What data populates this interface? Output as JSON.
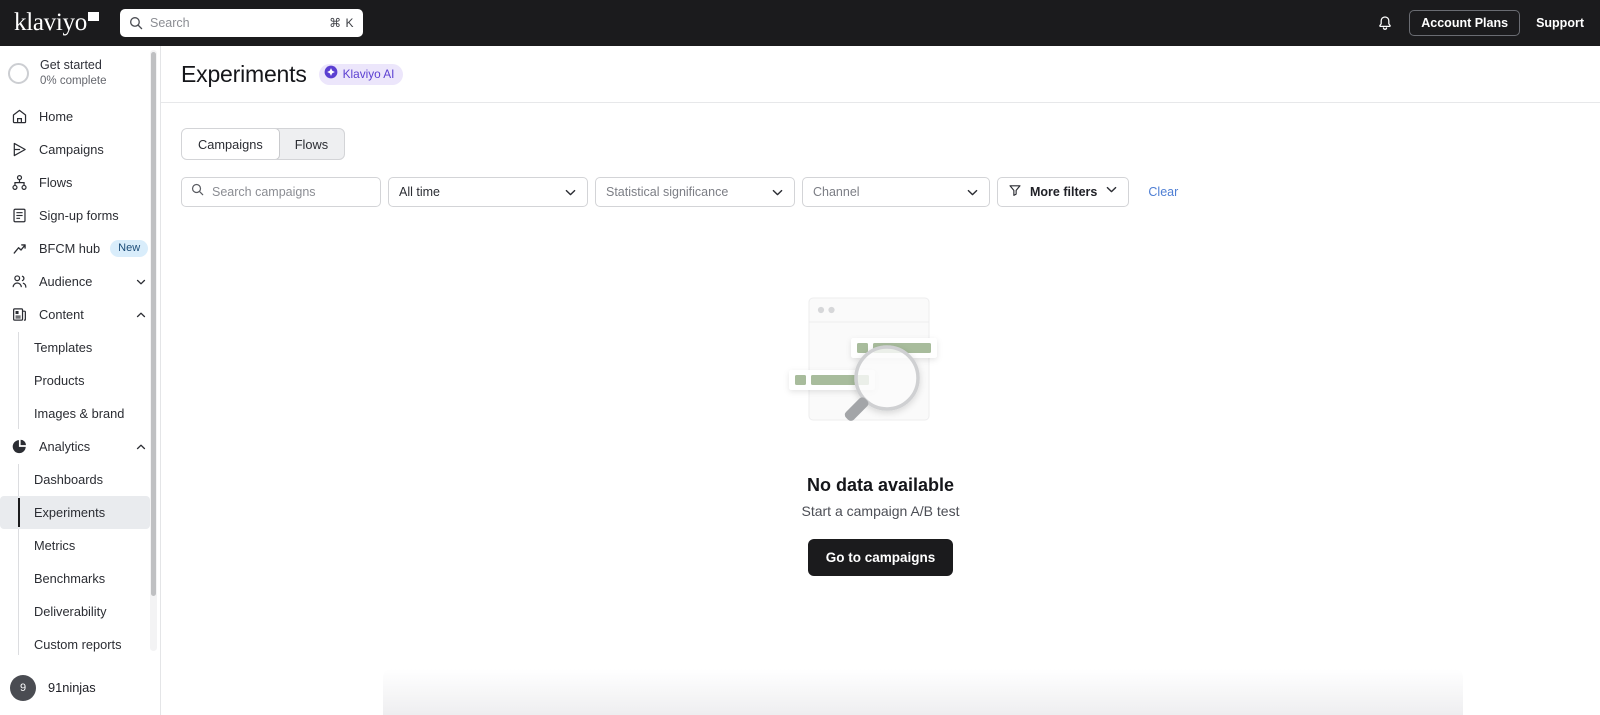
{
  "topbar": {
    "logo_text": "klaviyo",
    "search": {
      "placeholder": "Search",
      "shortcut": "⌘ K",
      "icon": "search-icon"
    },
    "notifications_icon": "bell-icon",
    "account_plans_label": "Account Plans",
    "support_label": "Support"
  },
  "sidebar": {
    "get_started": {
      "title": "Get started",
      "subtitle": "0% complete",
      "progress": 0
    },
    "items": [
      {
        "label": "Home",
        "icon": "home-icon"
      },
      {
        "label": "Campaigns",
        "icon": "send-icon"
      },
      {
        "label": "Flows",
        "icon": "flows-icon"
      },
      {
        "label": "Sign-up forms",
        "icon": "form-icon"
      },
      {
        "label": "BFCM hub",
        "icon": "trending-up-icon",
        "badge": "New"
      },
      {
        "label": "Audience",
        "icon": "people-icon",
        "chevron": "chevron-down-icon"
      },
      {
        "label": "Content",
        "icon": "content-icon",
        "chevron": "chevron-up-icon"
      }
    ],
    "content_children": [
      "Templates",
      "Products",
      "Images & brand"
    ],
    "analytics": {
      "label": "Analytics",
      "icon": "pie-chart-icon",
      "chevron": "chevron-up-icon"
    },
    "analytics_children": [
      "Dashboards",
      "Experiments",
      "Metrics",
      "Benchmarks",
      "Deliverability",
      "Custom reports"
    ],
    "active_item": "Experiments",
    "user": {
      "initial": "9",
      "name": "91ninjas"
    }
  },
  "page": {
    "title": "Experiments",
    "ai_badge": {
      "label": "Klaviyo AI",
      "icon": "klaviyo-ai-diamond-icon",
      "bg": "#ece6fb",
      "fg": "#5b3fd1"
    }
  },
  "tabs": [
    {
      "label": "Campaigns",
      "selected": true
    },
    {
      "label": "Flows",
      "selected": false
    }
  ],
  "filters": {
    "search": {
      "placeholder": "Search campaigns",
      "value": "",
      "icon": "search-icon"
    },
    "date_range": {
      "value": "All time",
      "is_placeholder": false
    },
    "significance": {
      "value": "Statistical significance",
      "is_placeholder": true
    },
    "channel": {
      "value": "Channel",
      "is_placeholder": true
    },
    "more_filters": {
      "label": "More filters",
      "icon": "funnel-icon"
    },
    "clear_label": "Clear",
    "clear_color": "#4f7fd4"
  },
  "empty_state": {
    "illustration": "no-search-results-illustration",
    "title": "No data available",
    "subtitle": "Start a campaign A/B test",
    "cta_label": "Go to campaigns"
  },
  "colors": {
    "topbar_bg": "#1b1b1d",
    "accent_purple": "#5b3fd1",
    "link_blue": "#4f7fd4",
    "badge_new_bg": "#d9edfb",
    "illustration_green": "#a8bc9c"
  }
}
